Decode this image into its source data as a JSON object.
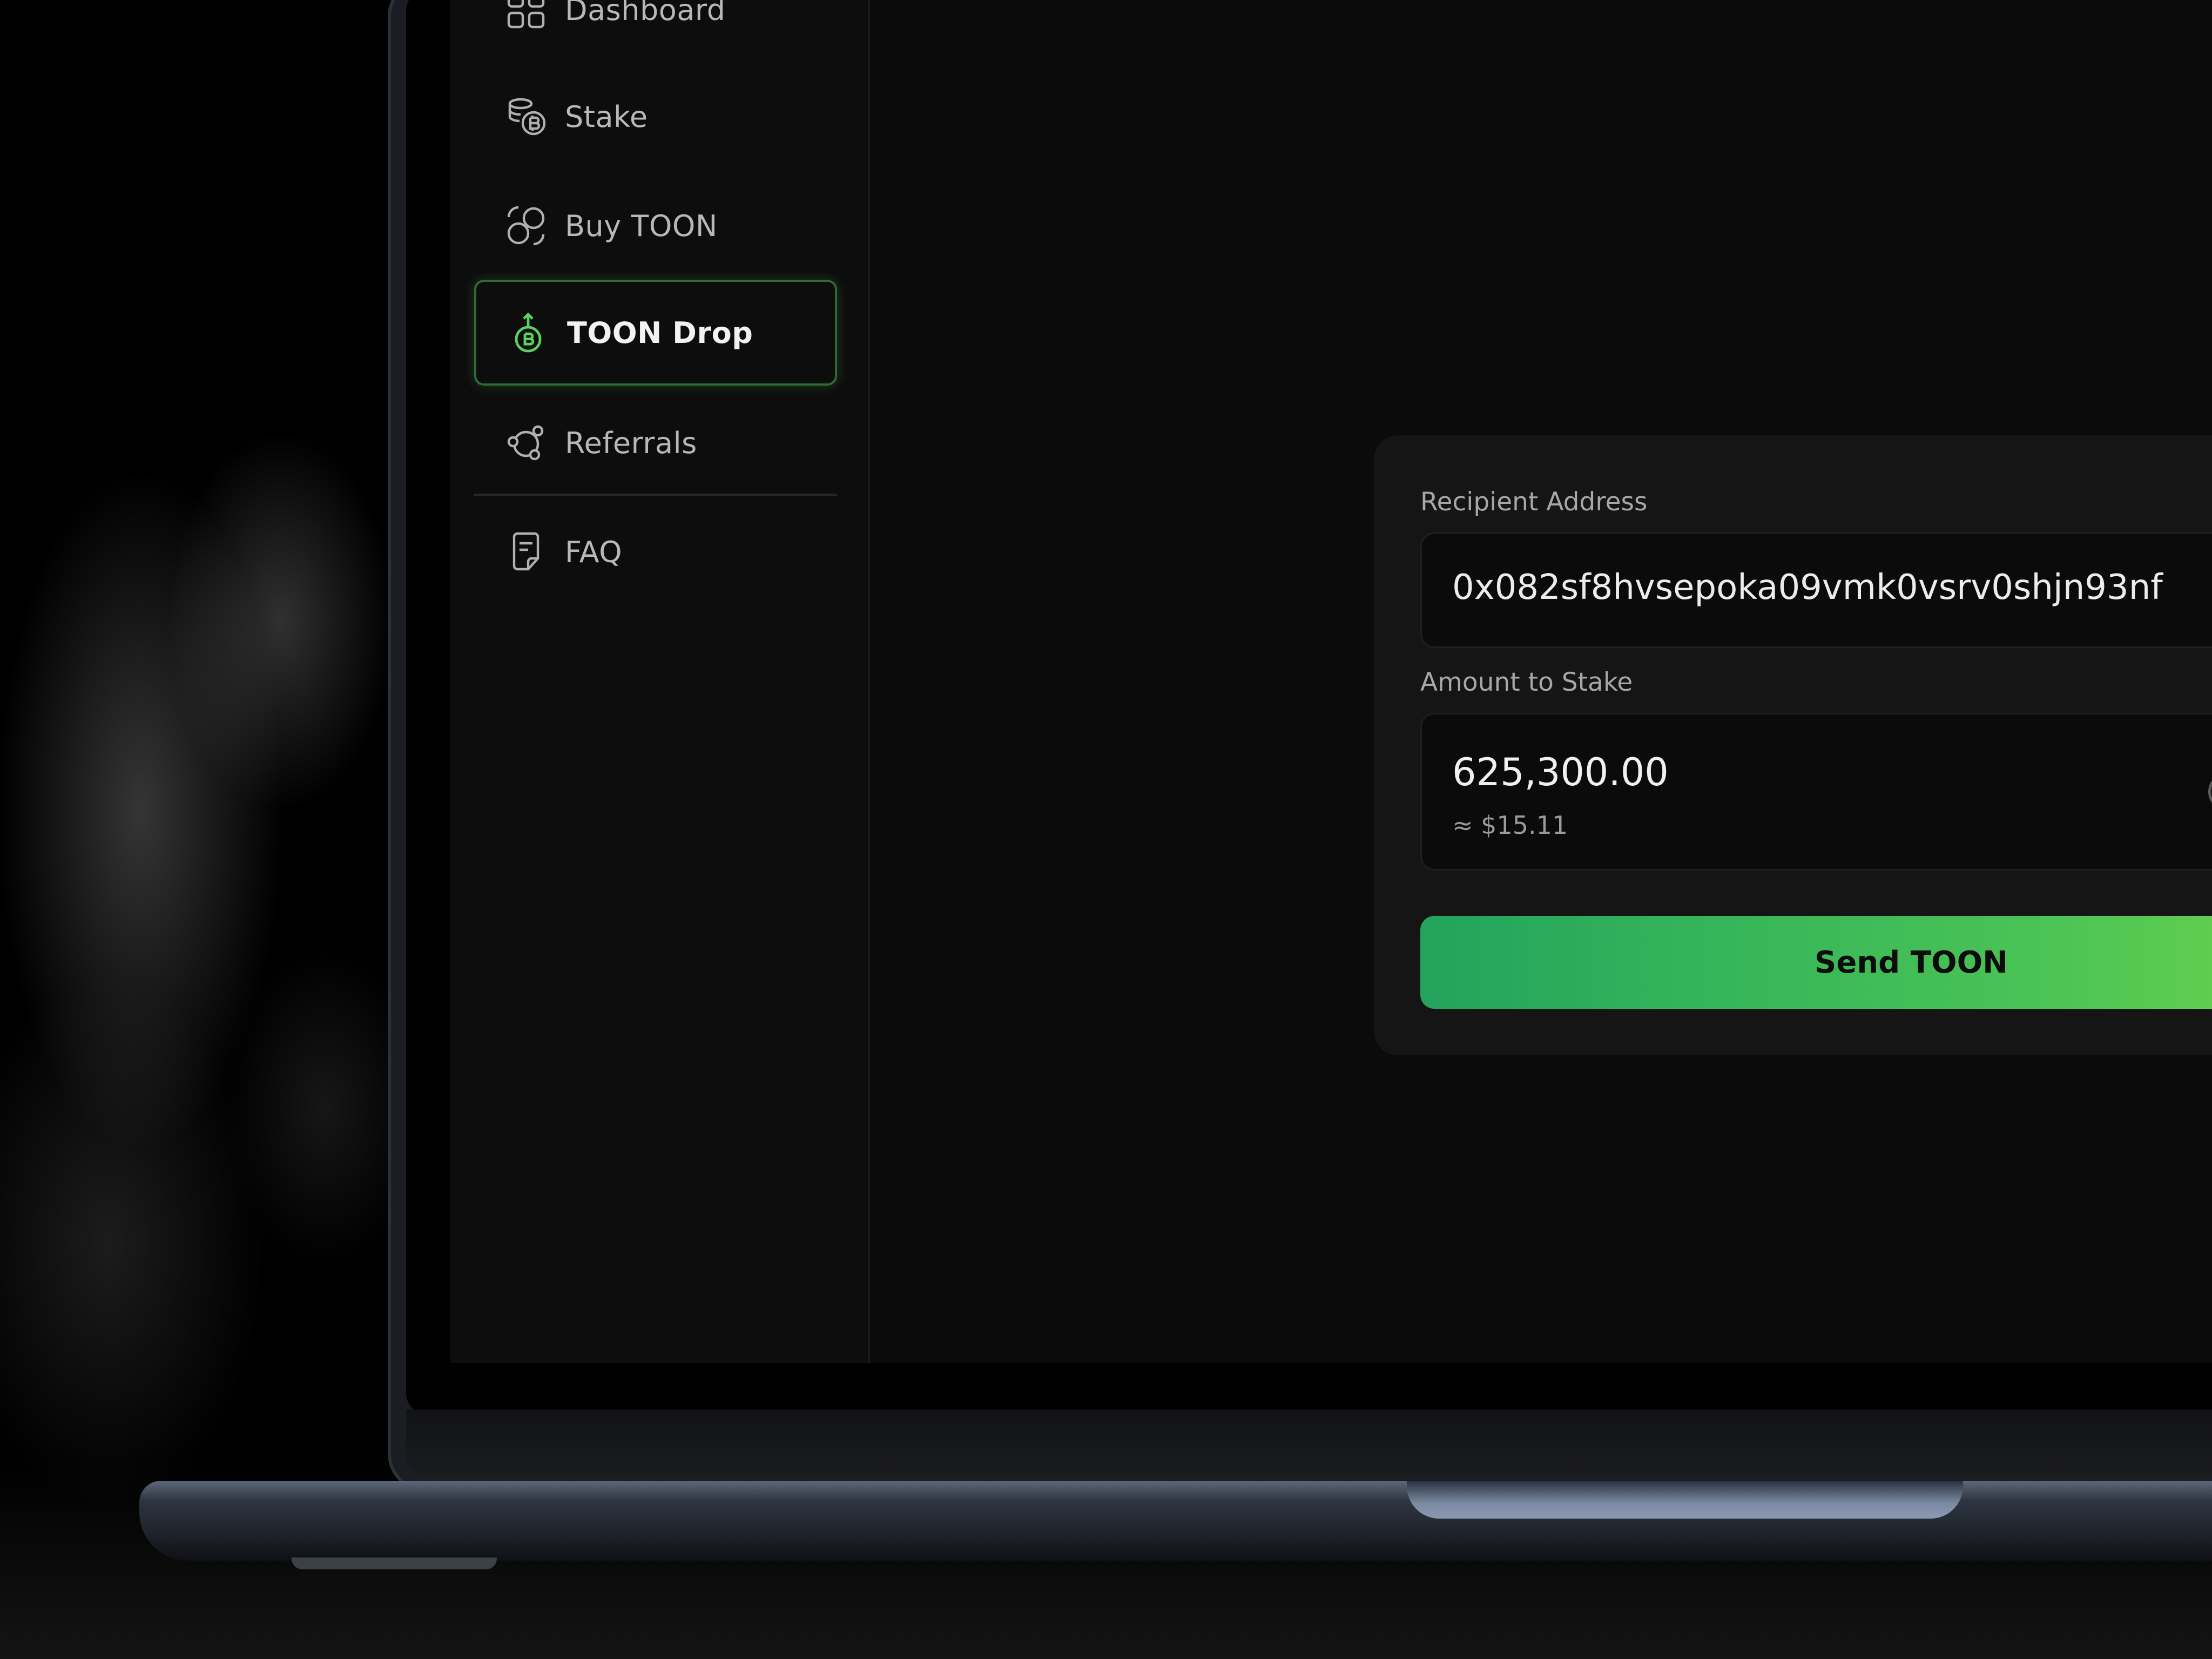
{
  "sidebar": {
    "items": [
      {
        "label": "Dashboard",
        "icon": "dashboard-icon",
        "active": false
      },
      {
        "label": "Stake",
        "icon": "stake-coins-icon",
        "active": false
      },
      {
        "label": "Buy TOON",
        "icon": "buy-exchange-icon",
        "active": false
      },
      {
        "label": "TOON Drop",
        "icon": "drop-coin-icon",
        "active": true
      },
      {
        "label": "Referrals",
        "icon": "referrals-network-icon",
        "active": false
      },
      {
        "label": "FAQ",
        "icon": "faq-document-icon",
        "active": false
      }
    ]
  },
  "form": {
    "recipient_label": "Recipient Address",
    "recipient_value": "0x082sf8hvsepoka09vmk0vsrv0shjn93nf",
    "amount_label": "Amount to Stake",
    "amount_value": "625,300.00",
    "amount_usd": "≈ $15.11",
    "submit_label": "Send TOON"
  },
  "colors": {
    "accent_green": "#4cc455",
    "active_border": "#2f6b34",
    "background": "#0b0b0b"
  }
}
